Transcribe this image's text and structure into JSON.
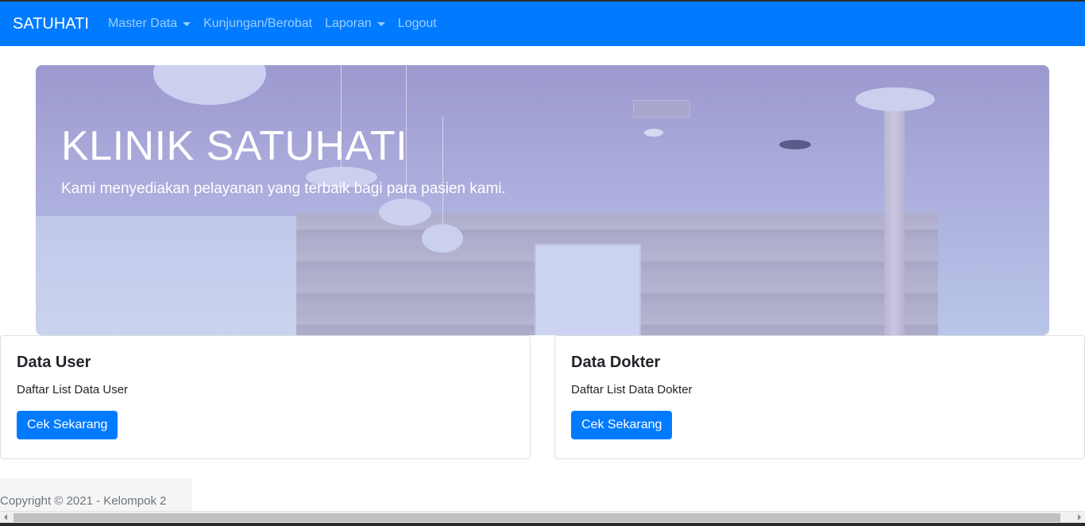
{
  "navbar": {
    "brand": "SATUHATI",
    "items": [
      {
        "label": "Master Data",
        "dropdown": true
      },
      {
        "label": "Kunjungan/Berobat",
        "dropdown": false
      },
      {
        "label": "Laporan",
        "dropdown": true
      },
      {
        "label": "Logout",
        "dropdown": false
      }
    ]
  },
  "hero": {
    "title": "KLINIK SATUHATI",
    "subtitle": "Kami menyediakan pelayanan yang terbaik bagi para pasien kami."
  },
  "cards": [
    {
      "title": "Data User",
      "text": "Daftar List Data User",
      "button": "Cek Sekarang"
    },
    {
      "title": "Data Dokter",
      "text": "Daftar List Data Dokter",
      "button": "Cek Sekarang"
    }
  ],
  "footer": {
    "text": "Copyright © 2021 - Kelompok 2"
  },
  "colors": {
    "primary": "#007bff",
    "navbar_text": "#ffffff"
  }
}
